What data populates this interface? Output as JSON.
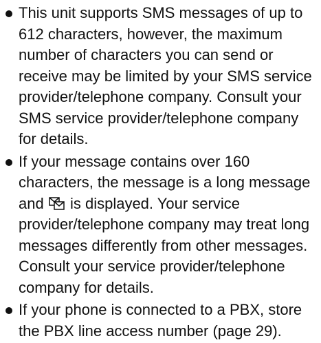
{
  "bullets": [
    {
      "text": "This unit supports SMS messages of up to 612 characters, however, the maximum number of characters you can send or receive may be limited by your SMS service provider/telephone company. Consult your SMS service provider/telephone company for details."
    },
    {
      "text_before_icon": "If your message contains over 160 characters, the message is a long message and",
      "icon": "long-message-icon",
      "text_after_icon": "is displayed. Your service provider/telephone company may treat long messages differently from other messages. Consult your service provider/telephone company for details."
    },
    {
      "text": "If your phone is connected to a PBX, store the PBX line access number (page 29)."
    }
  ]
}
